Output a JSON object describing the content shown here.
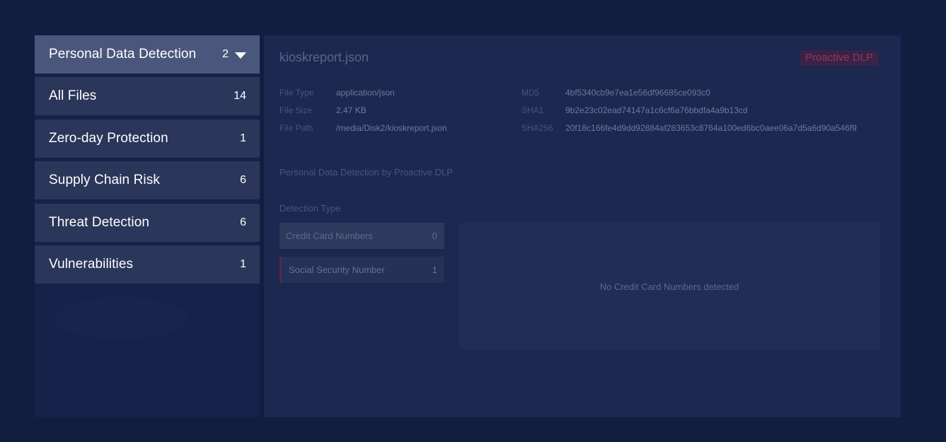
{
  "categories": [
    {
      "label": "Personal Data Detection",
      "count": "2",
      "active": true
    },
    {
      "label": "All Files",
      "count": "14"
    },
    {
      "label": "Zero-day Protection",
      "count": "1"
    },
    {
      "label": "Supply Chain Risk",
      "count": "6"
    },
    {
      "label": "Threat Detection",
      "count": "6"
    },
    {
      "label": "Vulnerabilities",
      "count": "1"
    }
  ],
  "file": {
    "name": "kioskreport.json",
    "badge": "Proactive DLP",
    "type_label": "File Type",
    "type_value": "application/json",
    "size_label": "File Size",
    "size_value": "2.47 KB",
    "path_label": "File Path",
    "path_value": "/media/Disk2/kioskreport.json",
    "md5_label": "MD5",
    "md5_value": "4bf5340cb9e7ea1e56df96685ce093c0",
    "sha1_label": "SHA1",
    "sha1_value": "9b2e23c02ead74147a1c6cf6a76bbdfa4a9b13cd",
    "sha256_label": "SHA256",
    "sha256_value": "20f18c166fe4d9dd92884af283653c8764a100ed6bc0aee06a7d5a6d90a546f9"
  },
  "detection": {
    "section_title": "Personal Data Detection by Proactive DLP",
    "type_label": "Detection Type",
    "types": [
      {
        "label": "Credit Card Numbers",
        "count": "0"
      },
      {
        "label": "Social Security Number",
        "count": "1"
      }
    ],
    "empty_message": "No Credit Card Numbers detected"
  },
  "colors": {
    "background": "#121e40",
    "active_category": "#4a577c",
    "category": "#2a375a",
    "badge_text": "#8f3a58"
  },
  "icons": {
    "dropdown": "chevron-down-icon"
  }
}
